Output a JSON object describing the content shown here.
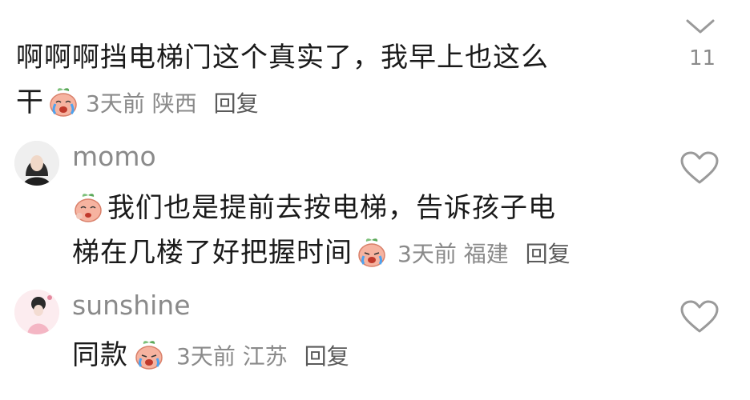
{
  "comments": [
    {
      "text_line1": "啊啊啊挡电梯门这个真实了，我早上也这么",
      "text_line2_prefix": "干",
      "meta": {
        "time": "3天前",
        "location": "陕西",
        "reply": "回复"
      },
      "like_count": "11",
      "emoji": "crying-peach-emoji"
    },
    {
      "username": "momo",
      "text_line1": "我们也是提前去按电梯，告诉孩子电",
      "text_line2_prefix": "梯在几楼了好把握时间",
      "meta": {
        "time": "3天前",
        "location": "福建",
        "reply": "回复"
      },
      "emoji": "crying-peach-emoji"
    },
    {
      "username": "sunshine",
      "text_line1_prefix": "同款",
      "meta": {
        "time": "3天前",
        "location": "江苏",
        "reply": "回复"
      },
      "emoji": "crying-peach-emoji"
    }
  ],
  "icons": {
    "collapse": "chevron-down-icon",
    "like": "heart-outline-icon"
  },
  "colors": {
    "text": "#1a1a1a",
    "meta": "#8a8a8a",
    "reply": "#5a5a5a",
    "icon": "#9a9a9a"
  }
}
